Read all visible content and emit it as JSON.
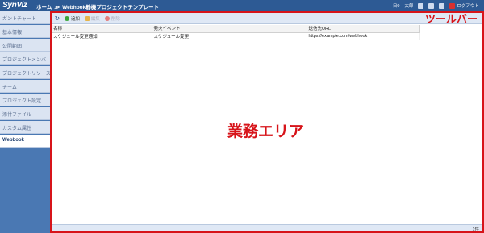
{
  "header": {
    "logo": "SynViz",
    "breadcrumb_home": "ホーム",
    "breadcrumb_sep": "≫",
    "breadcrumb_current": "Webhook静機プロジェクトテンプレート",
    "right_items": [
      "日0",
      "太郎"
    ],
    "logout": "ログアウト"
  },
  "sidebar": {
    "items": [
      {
        "label": "ガントチャート"
      },
      {
        "label": "基本情報"
      },
      {
        "label": "公開範囲"
      },
      {
        "label": "プロジェクトメンバ"
      },
      {
        "label": "プロジェクトリソース"
      },
      {
        "label": "チーム"
      },
      {
        "label": "プロジェクト設定"
      },
      {
        "label": "添付ファイル"
      },
      {
        "label": "カスタム属性"
      },
      {
        "label": "Webbook"
      }
    ]
  },
  "toolbar": {
    "add": "追加",
    "edit": "編集",
    "delete": "削除",
    "annotation": "ツールバー"
  },
  "table": {
    "headers": [
      "名称",
      "発火イベント",
      "送信先URL"
    ],
    "rows": [
      [
        "スケジュール変更通知",
        "スケジュール変更",
        "https://example.com/webhook"
      ]
    ]
  },
  "main_annotation": "業務エリア",
  "status": {
    "count": "1件"
  }
}
